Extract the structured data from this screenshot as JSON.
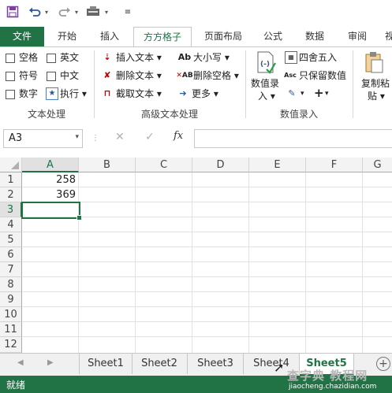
{
  "qat": {
    "save_icon": "save-icon",
    "undo_icon": "undo-icon",
    "redo_icon": "redo-icon",
    "customize_icon": "customize-icon"
  },
  "tabs": [
    "文件",
    "开始",
    "插入",
    "方方格子",
    "页面布局",
    "公式",
    "数据",
    "审阅",
    "视"
  ],
  "active_tab": "方方格子",
  "ribbon": {
    "text_processing": {
      "checkboxes": [
        "空格",
        "英文",
        "符号",
        "中文",
        "数字"
      ],
      "execute_label": "执行",
      "group_label": "文本处理"
    },
    "advanced_text": {
      "insert_text": "插入文本",
      "delete_text": "删除文本",
      "extract_text": "截取文本",
      "case_label": "大小写",
      "case_icon_text": "Ab",
      "delete_space": "删除空格",
      "delete_space_icon_text": "AB",
      "more_label": "更多",
      "group_label": "高级文本处理"
    },
    "numeric_entry": {
      "numeric_entry_label_line1": "数值录",
      "numeric_entry_label_line2": "入",
      "round_label": "四舍五入",
      "keep_value_label": "只保留数值",
      "abc_icon_text": "Asc",
      "plus_label": "+",
      "group_label": "数值录入"
    },
    "paste": {
      "label_line1": "复制粘",
      "label_line2": "贴"
    }
  },
  "formula_bar": {
    "name_box": "A3",
    "fx": "fx",
    "formula_value": ""
  },
  "columns": [
    "A",
    "B",
    "C",
    "D",
    "E",
    "F",
    "G"
  ],
  "rows": [
    "1",
    "2",
    "3",
    "4",
    "5",
    "6",
    "7",
    "8",
    "9",
    "10",
    "11",
    "12"
  ],
  "cells": {
    "A1": "258",
    "A2": "369"
  },
  "selected_cell": "A3",
  "sheets": [
    "Sheet1",
    "Sheet2",
    "Sheet3",
    "Sheet4",
    "Sheet5"
  ],
  "active_sheet": "Sheet5",
  "status": {
    "ready": "就绪"
  },
  "watermark": {
    "line1": "查字典 教程网",
    "line2": "jiaocheng.chazidian.com"
  },
  "colors": {
    "excel_green": "#217346",
    "selection": "#217346"
  }
}
